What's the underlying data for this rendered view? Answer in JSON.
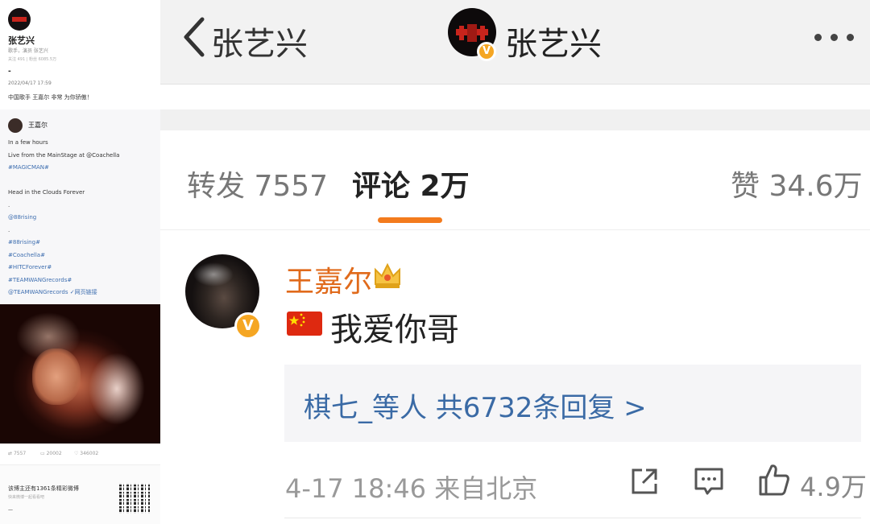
{
  "left_panel": {
    "profile_name": "张艺兴",
    "profile_sub": "歌手，演员 张艺兴",
    "profile_meta": "关注 491  |  粉丝 6085.5万",
    "dash": "-",
    "post_date": "2022/04/17 17:59",
    "post_text": "中国歌手 王嘉尔 非常 为你骄傲！",
    "repost_user": "王嘉尔",
    "repost_lines": [
      {
        "text": "In a few hours",
        "link": false
      },
      {
        "text": "Live from the MainStage at @Coachella",
        "link": false
      },
      {
        "text": "#MAGICMAN#",
        "link": true
      },
      {
        "text": "",
        "link": false
      },
      {
        "text": "Head in the Clouds Forever",
        "link": false
      },
      {
        "text": ".",
        "link": false
      },
      {
        "text": "@88rising",
        "link": true
      },
      {
        "text": ".",
        "link": false
      },
      {
        "text": "#88rising#",
        "link": true
      },
      {
        "text": "#Coachella#",
        "link": true
      },
      {
        "text": "#HITCForever#",
        "link": true
      },
      {
        "text": "#TEAMWANGrecords#",
        "link": true
      },
      {
        "text": "@TEAMWANGrecords ✓网页链接",
        "link": true
      }
    ],
    "stats": {
      "repost": "7557",
      "comment": "20002",
      "like": "346002"
    },
    "footer_text": "该博主还有1361条精彩微博",
    "footer_sub": "快来微博一起看看吧",
    "footer_dash": "—"
  },
  "header": {
    "back_label": "张艺兴",
    "title": "张艺兴",
    "verified_mark": "V"
  },
  "tabs": [
    {
      "label": "转发 7557",
      "active": false
    },
    {
      "label": "评论 2万",
      "active": true
    },
    {
      "label": "赞 34.6万",
      "active": false
    }
  ],
  "comment": {
    "author": "王嘉尔",
    "verified_mark": "V",
    "text": "我爱你哥",
    "replies_link": "棋七_等人  共6732条回复 >",
    "time": "4-17 18:46  来自北京",
    "like_count": "4.9万"
  },
  "colors": {
    "accent_orange": "#f37b1d",
    "name_orange": "#e06a1b",
    "link_blue": "#3a6aa5",
    "verified_gold": "#f5a623"
  }
}
